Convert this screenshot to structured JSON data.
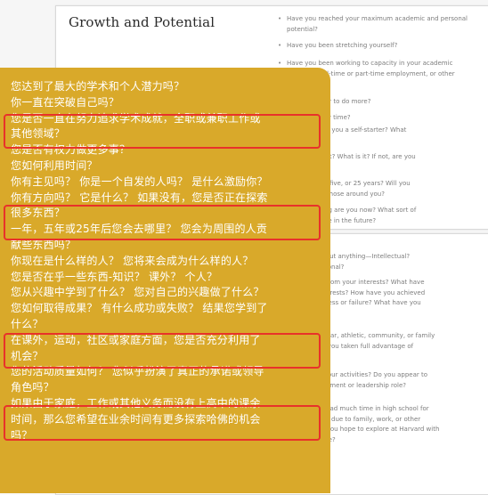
{
  "background_doc": {
    "section_title": "Growth and Potential",
    "bullets_top": [
      {
        "lines": [
          "Have you reached your maximum academic and personal",
          "potential?"
        ]
      },
      {
        "lines": [
          "Have you been stretching yourself?"
        ]
      },
      {
        "lines": [
          "Have you been working to capacity in your academic",
          "and other full-time or part-time employment, or other"
        ]
      },
      {
        "lines": [
          "reserve power to do more?"
        ]
      },
      {
        "lines": [
          "you used your time?"
        ]
      },
      {
        "lines": [
          "initiative? Are you a self-starter? What",
          "ou?"
        ]
      },
      {
        "lines": [
          "a direction yet? What is it? If not, are you",
          "any things?"
        ]
      },
      {
        "lines": [
          "ou be in one, five, or 25 years? Will you",
          "omething to those around you?"
        ]
      },
      {
        "lines": [
          "f human being are you now? What sort of",
          "ing will you be in the future?"
        ]
      }
    ],
    "bullets_bottom": [
      {
        "lines": [
          "re deeply about anything—Intellectual?",
          "rricular? Personal?"
        ]
      },
      {
        "lines": [
          "you learned from your interests? What have",
          "with your interests? How have you achieved",
          "ith what success or failure? What have you",
          "a result?"
        ]
      },
      {
        "lines": [
          "f extracurricular, athletic, community, or family",
          "ments, have you taken full advantage of",
          "ties?"
        ]
      },
      {
        "lines": [
          "e quality of your activities? Do you appear to",
          "nuine commitment or leadership role?"
        ]
      },
      {
        "lines": [
          "ou have not had much time in high school for",
          "cular pursuits due to family, work, or other",
          "ies, what do you hope to explore at Harvard with",
          "ional free time?"
        ]
      }
    ]
  },
  "overlay": {
    "lines": [
      "您达到了最大的学术和个人潜力吗？",
      "你一直在突破自己吗？",
      "您是否一直在努力追求学术成就，全职或兼职工作或",
      "其他领域？",
      "您是否有权力做更多事？",
      "您如何利用时间？",
      "你有主见吗？ 你是一个自发的人吗？ 是什么激励你？",
      "你有方向吗？ 它是什么？ 如果没有，您是否正在探索",
      "很多东西？",
      "一年，五年或25年后您会去哪里？ 您会为周围的人贡",
      "献些东西吗？",
      "你现在是什么样的人？ 您将来会成为什么样的人？",
      "您是否在乎一些东西-知识？ 课外？ 个人？",
      "您从兴趣中学到了什么？ 您对自己的兴趣做了什么？",
      "您如何取得成果？ 有什么成功或失败？ 结果您学到了",
      "什么？",
      "在课外，运动，社区或家庭方面，您是否充分利用了",
      "机会？",
      "您的活动质量如何？ 您似乎扮演了真正的承诺或领导",
      "角色吗？",
      "如果由于家庭，工作或其他义务而没有上高中的课余",
      "时间，那么您希望在业余时间有更多探索哈佛的机会",
      "吗？"
    ]
  },
  "colors": {
    "overlay_bg": "#d9a92a",
    "highlight_border": "#e8322a",
    "overlay_text": "#ffffff"
  }
}
